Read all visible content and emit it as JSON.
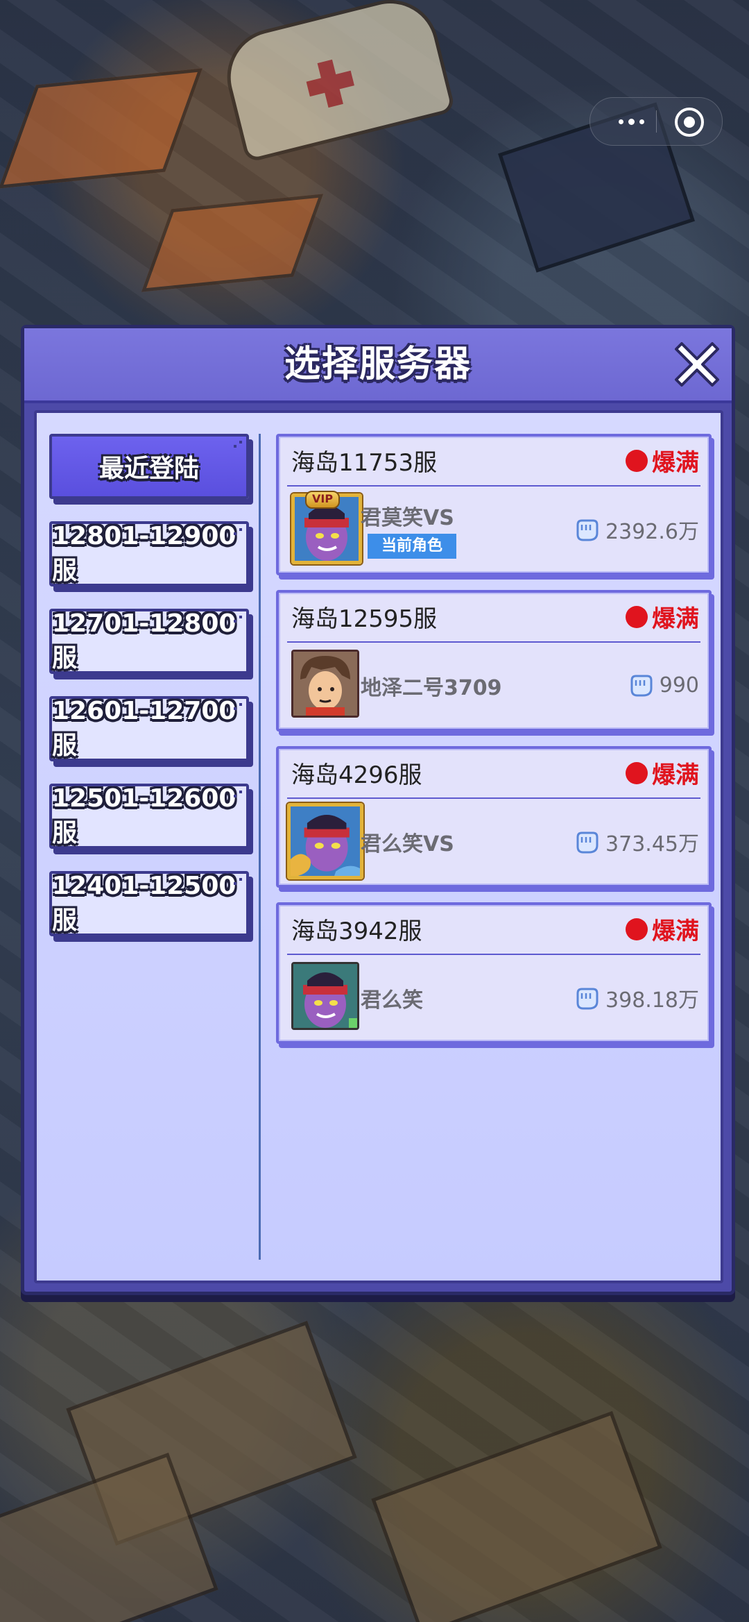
{
  "capsule": {
    "more_icon": "more-dots-icon",
    "close_icon": "target-icon"
  },
  "dialog": {
    "title": "选择服务器",
    "close_icon": "close-x-icon"
  },
  "tabs": [
    {
      "label": "最近登陆",
      "active": true
    },
    {
      "label": "12801-12900服",
      "active": false
    },
    {
      "label": "12701-12800服",
      "active": false
    },
    {
      "label": "12601-12700服",
      "active": false
    },
    {
      "label": "12501-12600服",
      "active": false
    },
    {
      "label": "12401-12500服",
      "active": false
    }
  ],
  "servers": [
    {
      "name": "海岛11753服",
      "status": "爆满",
      "character": "君莫笑VS",
      "current_role": "当前角色",
      "power": "2392.6万",
      "badge": "VIP"
    },
    {
      "name": "海岛12595服",
      "status": "爆满",
      "character": "地泽二号3709",
      "power": "990"
    },
    {
      "name": "海岛4296服",
      "status": "爆满",
      "character": "君么笑VS",
      "power": "373.45万"
    },
    {
      "name": "海岛3942服",
      "status": "爆满",
      "character": "君么笑",
      "power": "398.18万"
    }
  ],
  "colors": {
    "status_red": "#e0141e",
    "tab_active": "#5a4fde",
    "role_badge": "#3d8ee9"
  }
}
